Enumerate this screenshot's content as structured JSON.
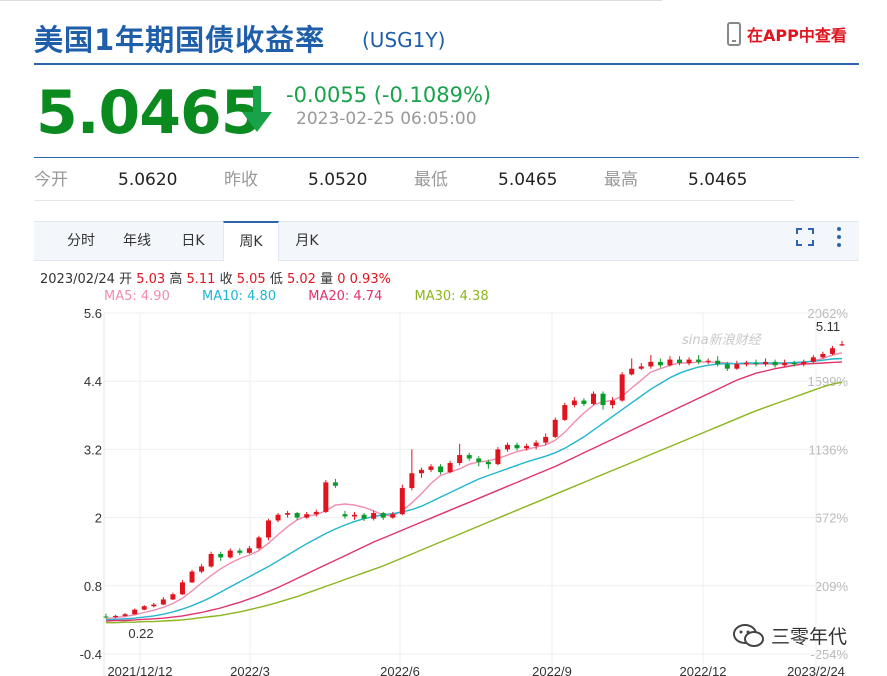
{
  "header": {
    "title": "美国1年期国债收益率",
    "code": "(USG1Y)",
    "app_link": "在APP中查看"
  },
  "quote": {
    "price": "5.0465",
    "change": "-0.0055 (-0.1089%)",
    "datetime": "2023-02-25 06:05:00",
    "direction": "down"
  },
  "stats": [
    {
      "label": "今开",
      "value": "5.0620"
    },
    {
      "label": "昨收",
      "value": "5.0520"
    },
    {
      "label": "最低",
      "value": "5.0465"
    },
    {
      "label": "最高",
      "value": "5.0465"
    }
  ],
  "tabs": [
    {
      "label": "分时",
      "active": false
    },
    {
      "label": "年线",
      "active": false
    },
    {
      "label": "日K",
      "active": false
    },
    {
      "label": "周K",
      "active": true
    },
    {
      "label": "月K",
      "active": false
    }
  ],
  "candle_info": {
    "date": "2023/02/24",
    "open_label": "开",
    "open": "5.03",
    "high_label": "高",
    "high": "5.11",
    "close_label": "收",
    "close": "5.05",
    "low_label": "低",
    "low": "5.02",
    "vol_label": "量",
    "vol": "0",
    "pct": "0.93%"
  },
  "ma_info": [
    {
      "text": "MA5: 4.90",
      "color": "#f08cb0"
    },
    {
      "text": "MA10: 4.80",
      "color": "#22b5cf"
    },
    {
      "text": "MA20: 4.74",
      "color": "#e0336a"
    },
    {
      "text": "MA30: 4.38",
      "color": "#8db51e"
    }
  ],
  "watermark": "sina新浪财经",
  "brand_watermark": "三零年代",
  "chart_data": {
    "type": "candlestick",
    "y_ticks": [
      "5.6",
      "4.4",
      "3.2",
      "2",
      "0.8",
      "-0.4"
    ],
    "y_right_ticks": [
      "2062%",
      "1599%",
      "1136%",
      "672%",
      "209%",
      "-254%"
    ],
    "x_ticks": [
      "2021/12/12",
      "2022/3",
      "2022/6",
      "2022/9",
      "2022/12",
      "2023/2/24"
    ],
    "ylim": [
      -0.4,
      5.6
    ],
    "annotations": {
      "max_label": "5.11",
      "min_label": "0.22"
    },
    "colors": {
      "up": "#e0141e",
      "down": "#0a9a2a",
      "ma5": "#f08cb0",
      "ma10": "#22b5cf",
      "ma20": "#e0336a",
      "ma30": "#8db51e"
    },
    "candles": [
      {
        "o": 0.26,
        "c": 0.25,
        "h": 0.31,
        "l": 0.22
      },
      {
        "o": 0.25,
        "c": 0.27,
        "h": 0.29,
        "l": 0.23
      },
      {
        "o": 0.27,
        "c": 0.3,
        "h": 0.32,
        "l": 0.26
      },
      {
        "o": 0.3,
        "c": 0.38,
        "h": 0.4,
        "l": 0.29
      },
      {
        "o": 0.38,
        "c": 0.44,
        "h": 0.46,
        "l": 0.37
      },
      {
        "o": 0.44,
        "c": 0.47,
        "h": 0.5,
        "l": 0.42
      },
      {
        "o": 0.47,
        "c": 0.56,
        "h": 0.6,
        "l": 0.46
      },
      {
        "o": 0.56,
        "c": 0.65,
        "h": 0.68,
        "l": 0.55
      },
      {
        "o": 0.65,
        "c": 0.86,
        "h": 0.9,
        "l": 0.64
      },
      {
        "o": 0.86,
        "c": 1.05,
        "h": 1.08,
        "l": 0.85
      },
      {
        "o": 1.05,
        "c": 1.14,
        "h": 1.18,
        "l": 1.02
      },
      {
        "o": 1.14,
        "c": 1.36,
        "h": 1.4,
        "l": 1.12
      },
      {
        "o": 1.36,
        "c": 1.3,
        "h": 1.4,
        "l": 1.24
      },
      {
        "o": 1.3,
        "c": 1.42,
        "h": 1.46,
        "l": 1.28
      },
      {
        "o": 1.42,
        "c": 1.38,
        "h": 1.46,
        "l": 1.34
      },
      {
        "o": 1.38,
        "c": 1.46,
        "h": 1.5,
        "l": 1.36
      },
      {
        "o": 1.46,
        "c": 1.65,
        "h": 1.68,
        "l": 1.44
      },
      {
        "o": 1.65,
        "c": 1.95,
        "h": 1.98,
        "l": 1.6
      },
      {
        "o": 1.95,
        "c": 2.05,
        "h": 2.08,
        "l": 1.92
      },
      {
        "o": 2.05,
        "c": 2.08,
        "h": 2.12,
        "l": 2.0
      },
      {
        "o": 2.08,
        "c": 2.0,
        "h": 2.1,
        "l": 1.96
      },
      {
        "o": 2.0,
        "c": 2.06,
        "h": 2.1,
        "l": 1.98
      },
      {
        "o": 2.06,
        "c": 2.1,
        "h": 2.14,
        "l": 2.02
      },
      {
        "o": 2.1,
        "c": 2.62,
        "h": 2.66,
        "l": 2.08
      },
      {
        "o": 2.62,
        "c": 2.56,
        "h": 2.68,
        "l": 2.52
      },
      {
        "o": 2.06,
        "c": 2.02,
        "h": 2.12,
        "l": 1.98
      },
      {
        "o": 2.02,
        "c": 2.05,
        "h": 2.1,
        "l": 1.96
      },
      {
        "o": 2.05,
        "c": 1.98,
        "h": 2.08,
        "l": 1.94
      },
      {
        "o": 1.98,
        "c": 2.08,
        "h": 2.12,
        "l": 1.95
      },
      {
        "o": 2.08,
        "c": 2.0,
        "h": 2.1,
        "l": 1.96
      },
      {
        "o": 2.0,
        "c": 2.06,
        "h": 2.1,
        "l": 1.98
      },
      {
        "o": 2.06,
        "c": 2.52,
        "h": 2.58,
        "l": 2.04
      },
      {
        "o": 2.52,
        "c": 2.78,
        "h": 3.2,
        "l": 2.48
      },
      {
        "o": 2.78,
        "c": 2.84,
        "h": 2.88,
        "l": 2.7
      },
      {
        "o": 2.84,
        "c": 2.9,
        "h": 2.94,
        "l": 2.8
      },
      {
        "o": 2.9,
        "c": 2.8,
        "h": 2.94,
        "l": 2.76
      },
      {
        "o": 2.8,
        "c": 2.96,
        "h": 3.0,
        "l": 2.78
      },
      {
        "o": 2.96,
        "c": 3.1,
        "h": 3.3,
        "l": 2.92
      },
      {
        "o": 3.1,
        "c": 3.04,
        "h": 3.14,
        "l": 3.0
      },
      {
        "o": 3.04,
        "c": 2.98,
        "h": 3.08,
        "l": 2.9
      },
      {
        "o": 2.98,
        "c": 2.94,
        "h": 3.02,
        "l": 2.86
      },
      {
        "o": 2.94,
        "c": 3.2,
        "h": 3.24,
        "l": 2.92
      },
      {
        "o": 3.2,
        "c": 3.28,
        "h": 3.32,
        "l": 3.16
      },
      {
        "o": 3.28,
        "c": 3.22,
        "h": 3.32,
        "l": 3.18
      },
      {
        "o": 3.22,
        "c": 3.26,
        "h": 3.3,
        "l": 3.18
      },
      {
        "o": 3.26,
        "c": 3.32,
        "h": 3.36,
        "l": 3.2
      },
      {
        "o": 3.32,
        "c": 3.42,
        "h": 3.48,
        "l": 3.28
      },
      {
        "o": 3.42,
        "c": 3.72,
        "h": 3.76,
        "l": 3.4
      },
      {
        "o": 3.72,
        "c": 3.98,
        "h": 4.02,
        "l": 3.7
      },
      {
        "o": 3.98,
        "c": 4.06,
        "h": 4.12,
        "l": 3.94
      },
      {
        "o": 4.06,
        "c": 4.0,
        "h": 4.1,
        "l": 3.96
      },
      {
        "o": 4.0,
        "c": 4.18,
        "h": 4.22,
        "l": 3.98
      },
      {
        "o": 4.18,
        "c": 3.98,
        "h": 4.22,
        "l": 3.9
      },
      {
        "o": 3.98,
        "c": 4.06,
        "h": 4.12,
        "l": 3.92
      },
      {
        "o": 4.06,
        "c": 4.52,
        "h": 4.56,
        "l": 4.04
      },
      {
        "o": 4.52,
        "c": 4.62,
        "h": 4.8,
        "l": 4.5
      },
      {
        "o": 4.62,
        "c": 4.66,
        "h": 4.72,
        "l": 4.6
      },
      {
        "o": 4.66,
        "c": 4.74,
        "h": 4.86,
        "l": 4.62
      },
      {
        "o": 4.74,
        "c": 4.68,
        "h": 4.8,
        "l": 4.64
      },
      {
        "o": 4.68,
        "c": 4.78,
        "h": 4.84,
        "l": 4.66
      },
      {
        "o": 4.78,
        "c": 4.72,
        "h": 4.84,
        "l": 4.68
      },
      {
        "o": 4.72,
        "c": 4.78,
        "h": 4.82,
        "l": 4.68
      },
      {
        "o": 4.78,
        "c": 4.74,
        "h": 4.86,
        "l": 4.7
      },
      {
        "o": 4.74,
        "c": 4.76,
        "h": 4.8,
        "l": 4.7
      },
      {
        "o": 4.76,
        "c": 4.7,
        "h": 4.84,
        "l": 4.66
      },
      {
        "o": 4.7,
        "c": 4.62,
        "h": 4.74,
        "l": 4.58
      },
      {
        "o": 4.62,
        "c": 4.7,
        "h": 4.76,
        "l": 4.6
      },
      {
        "o": 4.7,
        "c": 4.72,
        "h": 4.76,
        "l": 4.66
      },
      {
        "o": 4.72,
        "c": 4.7,
        "h": 4.78,
        "l": 4.66
      },
      {
        "o": 4.7,
        "c": 4.74,
        "h": 4.8,
        "l": 4.66
      },
      {
        "o": 4.74,
        "c": 4.68,
        "h": 4.78,
        "l": 4.64
      },
      {
        "o": 4.68,
        "c": 4.72,
        "h": 4.78,
        "l": 4.66
      },
      {
        "o": 4.72,
        "c": 4.7,
        "h": 4.76,
        "l": 4.66
      },
      {
        "o": 4.7,
        "c": 4.74,
        "h": 4.78,
        "l": 4.66
      },
      {
        "o": 4.74,
        "c": 4.82,
        "h": 4.86,
        "l": 4.72
      },
      {
        "o": 4.82,
        "c": 4.88,
        "h": 4.92,
        "l": 4.8
      },
      {
        "o": 4.88,
        "c": 4.98,
        "h": 5.02,
        "l": 4.86
      },
      {
        "o": 5.03,
        "c": 5.05,
        "h": 5.11,
        "l": 5.02
      }
    ],
    "series": [
      {
        "name": "MA5",
        "values": [
          0.22,
          0.24,
          0.26,
          0.29,
          0.33,
          0.37,
          0.42,
          0.49,
          0.58,
          0.71,
          0.85,
          0.98,
          1.1,
          1.2,
          1.28,
          1.34,
          1.42,
          1.55,
          1.7,
          1.84,
          1.96,
          2.03,
          2.05,
          2.12,
          2.22,
          2.24,
          2.22,
          2.18,
          2.12,
          2.04,
          2.03,
          2.12,
          2.26,
          2.42,
          2.6,
          2.74,
          2.8,
          2.86,
          2.94,
          2.98,
          3.0,
          3.04,
          3.1,
          3.16,
          3.2,
          3.24,
          3.28,
          3.36,
          3.5,
          3.68,
          3.84,
          3.98,
          4.04,
          4.06,
          4.14,
          4.28,
          4.42,
          4.56,
          4.62,
          4.68,
          4.72,
          4.72,
          4.74,
          4.74,
          4.73,
          4.72,
          4.7,
          4.7,
          4.7,
          4.7,
          4.7,
          4.71,
          4.71,
          4.72,
          4.76,
          4.8,
          4.86,
          4.9
        ]
      },
      {
        "name": "MA10",
        "values": [
          0.2,
          0.21,
          0.22,
          0.23,
          0.25,
          0.27,
          0.3,
          0.34,
          0.39,
          0.45,
          0.52,
          0.6,
          0.69,
          0.78,
          0.87,
          0.96,
          1.05,
          1.14,
          1.24,
          1.34,
          1.44,
          1.54,
          1.63,
          1.72,
          1.8,
          1.87,
          1.93,
          1.98,
          2.02,
          2.05,
          2.07,
          2.1,
          2.14,
          2.2,
          2.28,
          2.36,
          2.44,
          2.52,
          2.6,
          2.68,
          2.74,
          2.8,
          2.86,
          2.92,
          2.98,
          3.03,
          3.08,
          3.14,
          3.22,
          3.32,
          3.42,
          3.54,
          3.66,
          3.78,
          3.9,
          4.02,
          4.14,
          4.26,
          4.36,
          4.46,
          4.54,
          4.6,
          4.65,
          4.68,
          4.7,
          4.71,
          4.71,
          4.72,
          4.72,
          4.72,
          4.72,
          4.72,
          4.73,
          4.74,
          4.75,
          4.77,
          4.79,
          4.8
        ]
      },
      {
        "name": "MA20",
        "values": [
          0.18,
          0.19,
          0.19,
          0.2,
          0.21,
          0.22,
          0.23,
          0.25,
          0.27,
          0.3,
          0.33,
          0.37,
          0.41,
          0.46,
          0.51,
          0.57,
          0.63,
          0.7,
          0.77,
          0.85,
          0.93,
          1.01,
          1.09,
          1.17,
          1.25,
          1.33,
          1.41,
          1.49,
          1.57,
          1.64,
          1.71,
          1.78,
          1.85,
          1.92,
          1.99,
          2.06,
          2.13,
          2.2,
          2.27,
          2.34,
          2.41,
          2.48,
          2.55,
          2.62,
          2.69,
          2.76,
          2.83,
          2.9,
          2.98,
          3.06,
          3.14,
          3.22,
          3.3,
          3.38,
          3.46,
          3.54,
          3.62,
          3.7,
          3.78,
          3.86,
          3.94,
          4.02,
          4.1,
          4.18,
          4.26,
          4.34,
          4.42,
          4.48,
          4.54,
          4.58,
          4.62,
          4.65,
          4.68,
          4.7,
          4.71,
          4.72,
          4.73,
          4.74
        ]
      },
      {
        "name": "MA30",
        "values": [
          0.15,
          0.15,
          0.16,
          0.16,
          0.17,
          0.17,
          0.18,
          0.19,
          0.2,
          0.22,
          0.24,
          0.26,
          0.28,
          0.31,
          0.34,
          0.38,
          0.42,
          0.46,
          0.51,
          0.56,
          0.61,
          0.67,
          0.73,
          0.79,
          0.85,
          0.91,
          0.97,
          1.03,
          1.09,
          1.15,
          1.22,
          1.29,
          1.36,
          1.43,
          1.5,
          1.57,
          1.64,
          1.71,
          1.78,
          1.85,
          1.92,
          1.99,
          2.06,
          2.13,
          2.2,
          2.27,
          2.34,
          2.41,
          2.48,
          2.55,
          2.62,
          2.69,
          2.76,
          2.83,
          2.9,
          2.97,
          3.04,
          3.11,
          3.18,
          3.25,
          3.32,
          3.39,
          3.46,
          3.53,
          3.6,
          3.67,
          3.74,
          3.81,
          3.88,
          3.94,
          4.0,
          4.06,
          4.12,
          4.18,
          4.24,
          4.3,
          4.35,
          4.38
        ]
      }
    ]
  }
}
